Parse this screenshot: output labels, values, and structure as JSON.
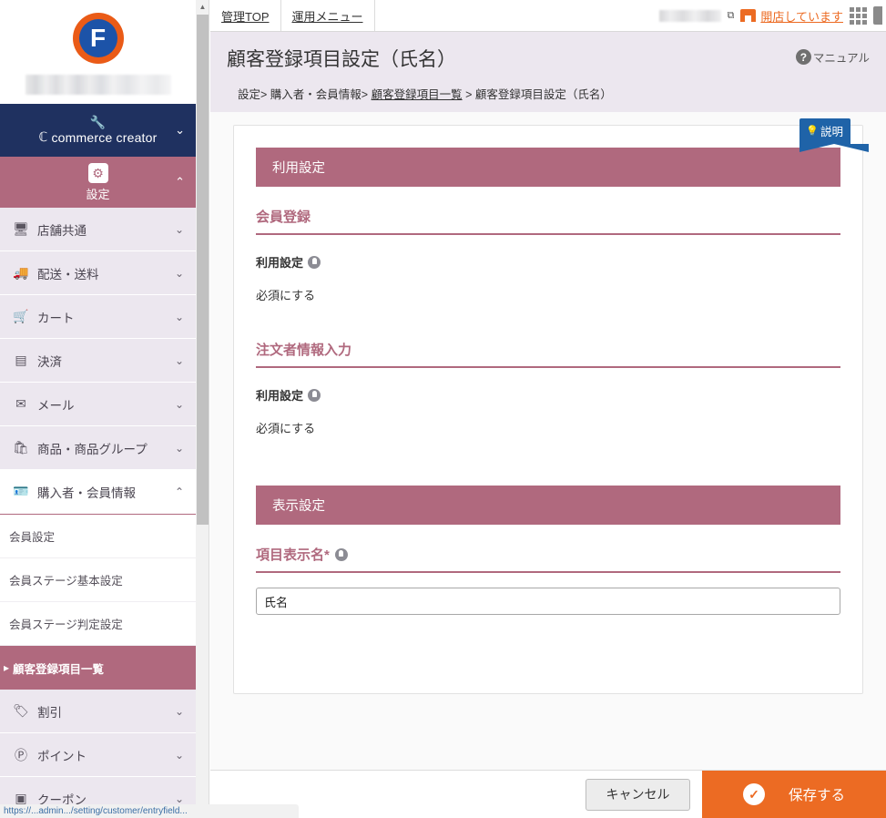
{
  "sidebar": {
    "brand": {
      "logo_letter": "F",
      "shop_name_redacted": "",
      "cc_label": "commerce creator",
      "wrench_icon": "wrench-icon",
      "chevron": "⌄"
    },
    "settings_section": {
      "label": "設定",
      "icon": "gear-icon",
      "chevron": "⌃"
    },
    "nav_items": [
      {
        "label": "店舗共通",
        "icon": "🖥",
        "icon_name": "monitor-icon",
        "chevron": "⌄",
        "open": false
      },
      {
        "label": "配送・送料",
        "icon": "🚚",
        "icon_name": "truck-icon",
        "chevron": "⌄",
        "open": false
      },
      {
        "label": "カート",
        "icon": "🛒",
        "icon_name": "cart-icon",
        "chevron": "⌄",
        "open": false
      },
      {
        "label": "決済",
        "icon": "▤",
        "icon_name": "credit-card-icon",
        "chevron": "⌄",
        "open": false
      },
      {
        "label": "メール",
        "icon": "✉",
        "icon_name": "mail-icon",
        "chevron": "⌄",
        "open": false
      },
      {
        "label": "商品・商品グループ",
        "icon": "🛍",
        "icon_name": "bag-icon",
        "chevron": "⌄",
        "open": false
      },
      {
        "label": "購入者・会員情報",
        "icon": "🪪",
        "icon_name": "id-card-icon",
        "chevron": "⌃",
        "open": true
      }
    ],
    "sub_items": [
      {
        "label": "会員設定",
        "active": false
      },
      {
        "label": "会員ステージ基本設定",
        "active": false
      },
      {
        "label": "会員ステージ判定設定",
        "active": false
      },
      {
        "label": "顧客登録項目一覧",
        "active": true
      }
    ],
    "nav_items_lower": [
      {
        "label": "割引",
        "icon": "🏷",
        "icon_name": "tag-icon",
        "chevron": "⌄"
      },
      {
        "label": "ポイント",
        "icon": "Ⓟ",
        "icon_name": "point-icon",
        "chevron": "⌄"
      },
      {
        "label": "クーポン",
        "icon": "▣",
        "icon_name": "coupon-icon",
        "chevron": "⌄"
      }
    ],
    "scrollbar": {
      "up_arrow": "▲",
      "down_arrow": "▼"
    }
  },
  "topbar": {
    "tabs": [
      {
        "label": "管理TOP"
      },
      {
        "label": "運用メニュー"
      }
    ],
    "account_redacted": "",
    "external_link_icon": "⧉",
    "store_status_label": "開店しています",
    "store_icon_name": "storefront-icon",
    "grid_icon_name": "apps-grid-icon",
    "rail_icon_name": "side-panel-icon"
  },
  "page": {
    "title": "顧客登録項目設定（氏名）",
    "manual_label": "マニュアル",
    "manual_icon": "question-mark-icon",
    "breadcrumb": {
      "parts": [
        {
          "text": "設定>",
          "link": false
        },
        {
          "text": "購入者・会員情報>",
          "link": false
        },
        {
          "text": "顧客登録項目一覧",
          "link": true
        },
        {
          "text": "> 顧客登録項目設定（氏名）",
          "link": false
        }
      ]
    }
  },
  "card": {
    "help_badge": {
      "label": "説明",
      "icon": "lightbulb-icon"
    },
    "section1": {
      "header": "利用設定",
      "groups": [
        {
          "title": "会員登録",
          "field_label": "利用設定",
          "field_help_icon": "lightbulb-help-icon",
          "field_value": "必須にする"
        },
        {
          "title": "注文者情報入力",
          "field_label": "利用設定",
          "field_help_icon": "lightbulb-help-icon",
          "field_value": "必須にする"
        }
      ]
    },
    "section2": {
      "header": "表示設定",
      "field_label": "項目表示名*",
      "field_help_icon": "lightbulb-help-icon",
      "input_value": "氏名",
      "input_placeholder": ""
    }
  },
  "footer": {
    "cancel_label": "キャンセル",
    "save_label": "保存する",
    "save_icon": "check-circle-icon"
  },
  "status_bar": {
    "url_text": "https://...admin.../setting/customer/entryfield..."
  },
  "colors": {
    "accent_rose": "#b0697e",
    "brand_navy": "#1f3160",
    "orange": "#ec6b23",
    "badge_blue": "#1f63a8",
    "sidebar_bg": "#ece7ef"
  }
}
